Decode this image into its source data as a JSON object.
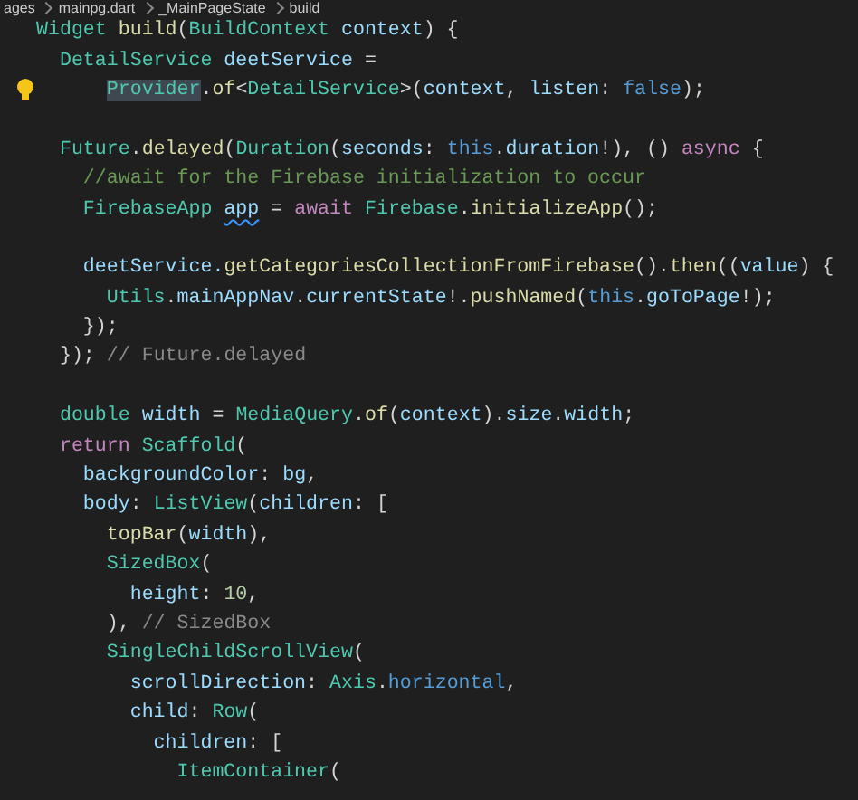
{
  "breadcrumb": [
    "ages",
    "mainpg.dart",
    "_MainPageState",
    "build"
  ],
  "lines": [
    {
      "tokens": [
        {
          "t": "Widget ",
          "kind": "type"
        },
        {
          "t": "build",
          "kind": "fn"
        },
        {
          "t": "(",
          "kind": "plain"
        },
        {
          "t": "BuildContext ",
          "kind": "type"
        },
        {
          "t": "context",
          "kind": "var"
        },
        {
          "t": ") {",
          "kind": "plain"
        }
      ]
    },
    {
      "tokens": [
        {
          "t": "  DetailService",
          "kind": "type"
        },
        {
          "t": " deetService",
          "kind": "var"
        },
        {
          "t": " =",
          "kind": "plain"
        }
      ]
    },
    {
      "lightbulb": true,
      "tokens": [
        {
          "t": "      Provider",
          "kind": "highlight"
        },
        {
          "t": ".",
          "kind": "plain"
        },
        {
          "t": "of",
          "kind": "fn"
        },
        {
          "t": "<",
          "kind": "plain"
        },
        {
          "t": "DetailService",
          "kind": "type"
        },
        {
          "t": ">(",
          "kind": "plain"
        },
        {
          "t": "context",
          "kind": "var"
        },
        {
          "t": ", ",
          "kind": "plain"
        },
        {
          "t": "listen",
          "kind": "var"
        },
        {
          "t": ": ",
          "kind": "plain"
        },
        {
          "t": "false",
          "kind": "const"
        },
        {
          "t": ");",
          "kind": "plain"
        }
      ]
    },
    {
      "blank_before": true,
      "tokens": [
        {
          "t": "  Future",
          "kind": "type"
        },
        {
          "t": ".",
          "kind": "plain"
        },
        {
          "t": "delayed",
          "kind": "fn"
        },
        {
          "t": "(",
          "kind": "plain"
        },
        {
          "t": "Duration",
          "kind": "type"
        },
        {
          "t": "(",
          "kind": "plain"
        },
        {
          "t": "seconds",
          "kind": "var"
        },
        {
          "t": ": ",
          "kind": "plain"
        },
        {
          "t": "this",
          "kind": "const"
        },
        {
          "t": ".",
          "kind": "plain"
        },
        {
          "t": "duration",
          "kind": "var"
        },
        {
          "t": "!), () ",
          "kind": "plain"
        },
        {
          "t": "async",
          "kind": "keyword"
        },
        {
          "t": " {",
          "kind": "plain"
        }
      ]
    },
    {
      "tokens": [
        {
          "t": "    //await for the Firebase initialization to occur",
          "kind": "comment"
        }
      ]
    },
    {
      "tokens": [
        {
          "t": "    FirebaseApp ",
          "kind": "type"
        },
        {
          "t": "app",
          "kind": "squiggle"
        },
        {
          "t": " = ",
          "kind": "plain"
        },
        {
          "t": "await ",
          "kind": "keyword"
        },
        {
          "t": "Firebase",
          "kind": "type"
        },
        {
          "t": ".",
          "kind": "plain"
        },
        {
          "t": "initializeApp",
          "kind": "fn"
        },
        {
          "t": "();",
          "kind": "plain"
        }
      ]
    },
    {
      "blank_before": true,
      "tokens": [
        {
          "t": "    deetService.",
          "kind": "var"
        },
        {
          "t": "getCategoriesCollectionFromFirebase",
          "kind": "fn"
        },
        {
          "t": "().",
          "kind": "plain"
        },
        {
          "t": "then",
          "kind": "fn"
        },
        {
          "t": "((",
          "kind": "plain"
        },
        {
          "t": "value",
          "kind": "var"
        },
        {
          "t": ") {",
          "kind": "plain"
        }
      ]
    },
    {
      "tokens": [
        {
          "t": "      Utils",
          "kind": "type"
        },
        {
          "t": ".",
          "kind": "plain"
        },
        {
          "t": "mainAppNav",
          "kind": "var"
        },
        {
          "t": ".",
          "kind": "plain"
        },
        {
          "t": "currentState",
          "kind": "var"
        },
        {
          "t": "!.",
          "kind": "plain"
        },
        {
          "t": "pushNamed",
          "kind": "fn"
        },
        {
          "t": "(",
          "kind": "plain"
        },
        {
          "t": "this",
          "kind": "const"
        },
        {
          "t": ".",
          "kind": "plain"
        },
        {
          "t": "goToPage",
          "kind": "var"
        },
        {
          "t": "!);",
          "kind": "plain"
        }
      ]
    },
    {
      "tokens": [
        {
          "t": "    });",
          "kind": "plain"
        }
      ]
    },
    {
      "tokens": [
        {
          "t": "  });",
          "kind": "plain"
        },
        {
          "t": " // Future.delayed",
          "kind": "label"
        }
      ]
    },
    {
      "blank_before": true,
      "tokens": [
        {
          "t": "  double ",
          "kind": "type"
        },
        {
          "t": "width",
          "kind": "var"
        },
        {
          "t": " = ",
          "kind": "plain"
        },
        {
          "t": "MediaQuery",
          "kind": "type"
        },
        {
          "t": ".",
          "kind": "plain"
        },
        {
          "t": "of",
          "kind": "fn"
        },
        {
          "t": "(",
          "kind": "plain"
        },
        {
          "t": "context",
          "kind": "var"
        },
        {
          "t": ").",
          "kind": "plain"
        },
        {
          "t": "size",
          "kind": "var"
        },
        {
          "t": ".",
          "kind": "plain"
        },
        {
          "t": "width",
          "kind": "var"
        },
        {
          "t": ";",
          "kind": "plain"
        }
      ]
    },
    {
      "tokens": [
        {
          "t": "  return ",
          "kind": "keyword"
        },
        {
          "t": "Scaffold",
          "kind": "type"
        },
        {
          "t": "(",
          "kind": "plain"
        }
      ]
    },
    {
      "tokens": [
        {
          "t": "    backgroundColor",
          "kind": "var"
        },
        {
          "t": ": ",
          "kind": "plain"
        },
        {
          "t": "bg",
          "kind": "var"
        },
        {
          "t": ",",
          "kind": "plain"
        }
      ]
    },
    {
      "tokens": [
        {
          "t": "    body",
          "kind": "var"
        },
        {
          "t": ": ",
          "kind": "plain"
        },
        {
          "t": "ListView",
          "kind": "type"
        },
        {
          "t": "(",
          "kind": "plain"
        },
        {
          "t": "children",
          "kind": "var"
        },
        {
          "t": ": [",
          "kind": "plain"
        }
      ]
    },
    {
      "tokens": [
        {
          "t": "      topBar",
          "kind": "fn"
        },
        {
          "t": "(",
          "kind": "plain"
        },
        {
          "t": "width",
          "kind": "var"
        },
        {
          "t": "),",
          "kind": "plain"
        }
      ]
    },
    {
      "tokens": [
        {
          "t": "      SizedBox",
          "kind": "type"
        },
        {
          "t": "(",
          "kind": "plain"
        }
      ]
    },
    {
      "tokens": [
        {
          "t": "        height",
          "kind": "var"
        },
        {
          "t": ": ",
          "kind": "plain"
        },
        {
          "t": "10",
          "kind": "number"
        },
        {
          "t": ",",
          "kind": "plain"
        }
      ]
    },
    {
      "tokens": [
        {
          "t": "      ),",
          "kind": "plain"
        },
        {
          "t": " // SizedBox",
          "kind": "label"
        }
      ]
    },
    {
      "tokens": [
        {
          "t": "      SingleChildScrollView",
          "kind": "type"
        },
        {
          "t": "(",
          "kind": "plain"
        }
      ]
    },
    {
      "tokens": [
        {
          "t": "        scrollDirection",
          "kind": "var"
        },
        {
          "t": ": ",
          "kind": "plain"
        },
        {
          "t": "Axis",
          "kind": "type"
        },
        {
          "t": ".",
          "kind": "plain"
        },
        {
          "t": "horizontal",
          "kind": "const"
        },
        {
          "t": ",",
          "kind": "plain"
        }
      ]
    },
    {
      "tokens": [
        {
          "t": "        child",
          "kind": "var"
        },
        {
          "t": ": ",
          "kind": "plain"
        },
        {
          "t": "Row",
          "kind": "type"
        },
        {
          "t": "(",
          "kind": "plain"
        }
      ]
    },
    {
      "tokens": [
        {
          "t": "          children",
          "kind": "var"
        },
        {
          "t": ": [",
          "kind": "plain"
        }
      ]
    },
    {
      "tokens": [
        {
          "t": "            ItemContainer",
          "kind": "type"
        },
        {
          "t": "(",
          "kind": "plain"
        }
      ]
    }
  ]
}
